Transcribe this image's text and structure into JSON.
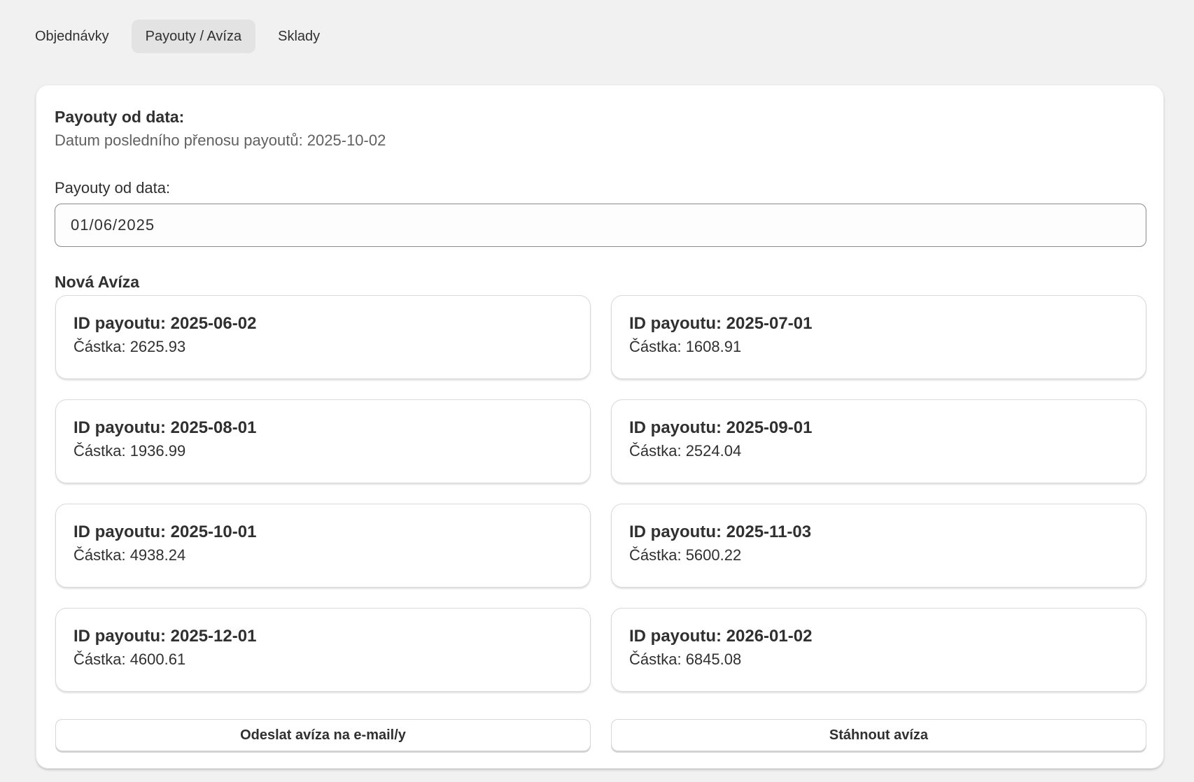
{
  "tabs": [
    {
      "label": "Objednávky",
      "active": false
    },
    {
      "label": "Payouty / Avíza",
      "active": true
    },
    {
      "label": "Sklady",
      "active": false
    }
  ],
  "section": {
    "title": "Payouty od data:",
    "subtitle": "Datum posledního přenosu payoutů: 2025-10-02",
    "field_label": "Payouty od data:",
    "date_value": "01/06/2025"
  },
  "new_notices": {
    "title": "Nová Avíza",
    "items": [
      {
        "id": "ID payoutu: 2025-06-02",
        "amount": "Částka: 2625.93"
      },
      {
        "id": "ID payoutu: 2025-07-01",
        "amount": "Částka: 1608.91"
      },
      {
        "id": "ID payoutu: 2025-08-01",
        "amount": "Částka: 1936.99"
      },
      {
        "id": "ID payoutu: 2025-09-01",
        "amount": "Částka: 2524.04"
      },
      {
        "id": "ID payoutu: 2025-10-01",
        "amount": "Částka: 4938.24"
      },
      {
        "id": "ID payoutu: 2025-11-03",
        "amount": "Částka: 5600.22"
      },
      {
        "id": "ID payoutu: 2025-12-01",
        "amount": "Částka: 4600.61"
      },
      {
        "id": "ID payoutu: 2026-01-02",
        "amount": "Částka: 6845.08"
      }
    ]
  },
  "actions": {
    "send_label": "Odeslat avíza na e-mail/y",
    "download_label": "Stáhnout avíza"
  }
}
